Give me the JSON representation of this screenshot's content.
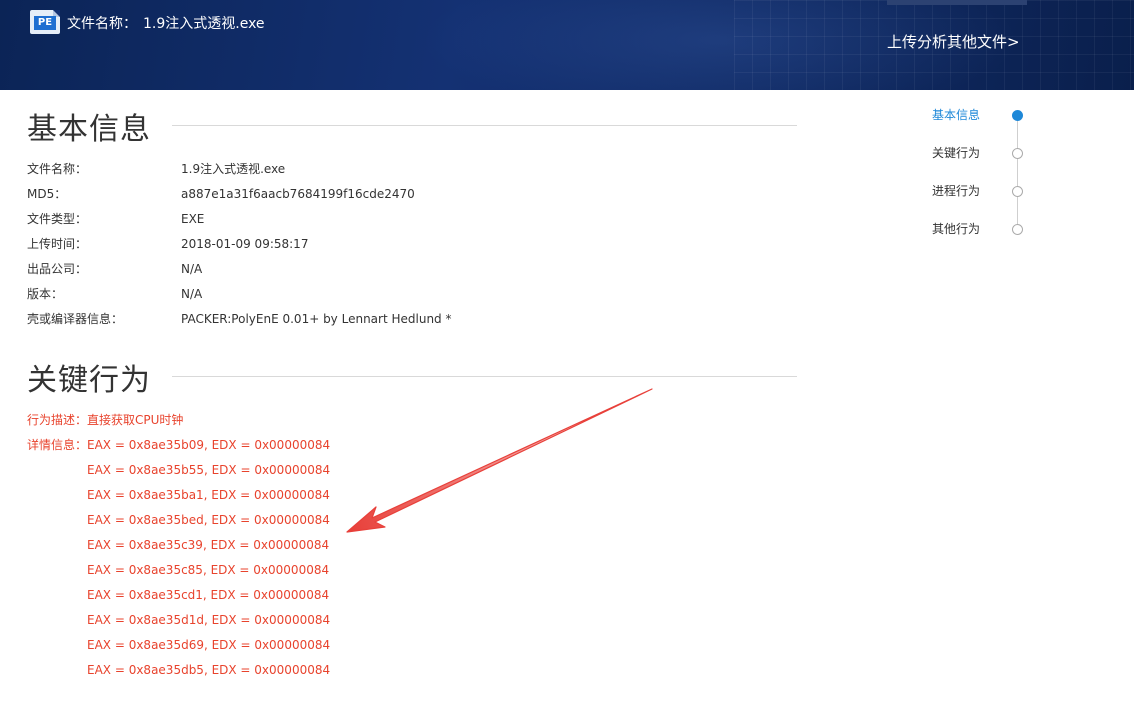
{
  "header": {
    "file_label": "文件名称：",
    "file_name": "1.9注入式透视.exe",
    "icon_text": "PE",
    "upload_link": "上传分析其他文件>"
  },
  "basic_info": {
    "title": "基本信息",
    "rows": [
      {
        "label": "文件名称：",
        "value": "1.9注入式透视.exe"
      },
      {
        "label": "MD5：",
        "value": "a887e1a31f6aacb7684199f16cde2470"
      },
      {
        "label": "文件类型：",
        "value": "EXE"
      },
      {
        "label": "上传时间：",
        "value": "2018-01-09 09:58:17"
      },
      {
        "label": "出品公司：",
        "value": "N/A"
      },
      {
        "label": "版本：",
        "value": "N/A"
      },
      {
        "label": "壳或编译器信息：",
        "value": "PACKER:PolyEnE 0.01+ by Lennart Hedlund *"
      }
    ]
  },
  "key_behavior": {
    "title": "关键行为",
    "desc_label": "行为描述：",
    "desc_value": "直接获取CPU时钟",
    "detail_label": "详情信息：",
    "details": [
      "EAX = 0x8ae35b09, EDX = 0x00000084",
      "EAX = 0x8ae35b55, EDX = 0x00000084",
      "EAX = 0x8ae35ba1, EDX = 0x00000084",
      "EAX = 0x8ae35bed, EDX = 0x00000084",
      "EAX = 0x8ae35c39, EDX = 0x00000084",
      "EAX = 0x8ae35c85, EDX = 0x00000084",
      "EAX = 0x8ae35cd1, EDX = 0x00000084",
      "EAX = 0x8ae35d1d, EDX = 0x00000084",
      "EAX = 0x8ae35d69, EDX = 0x00000084",
      "EAX = 0x8ae35db5, EDX = 0x00000084"
    ]
  },
  "timeline": {
    "items": [
      {
        "label": "基本信息",
        "active": true
      },
      {
        "label": "关键行为",
        "active": false
      },
      {
        "label": "进程行为",
        "active": false
      },
      {
        "label": "其他行为",
        "active": false
      }
    ]
  },
  "colors": {
    "header_bg": "#123070",
    "accent_blue": "#1e88d8",
    "behavior_red": "#e8432d",
    "annotation_arrow": "#e8403a"
  }
}
